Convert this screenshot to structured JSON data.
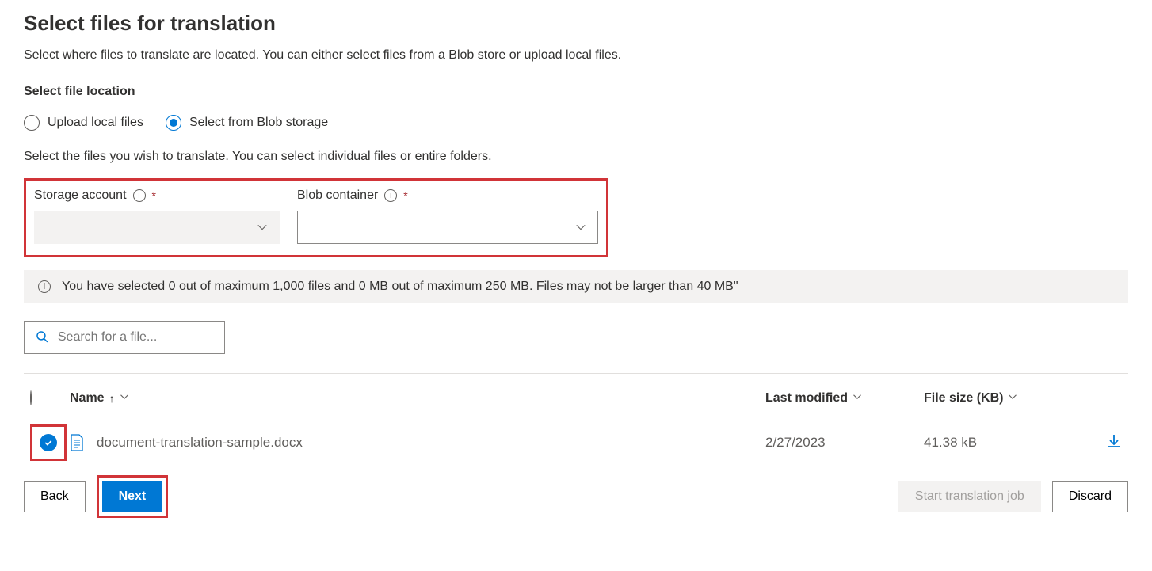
{
  "page": {
    "title": "Select files for translation",
    "subtitle": "Select where files to translate are located. You can either select files from a Blob store or upload local files.",
    "sectionLabel": "Select file location",
    "instruction": "Select the files you wish to translate. You can select individual files or entire folders."
  },
  "radios": {
    "uploadLocal": "Upload local files",
    "selectBlob": "Select from Blob storage"
  },
  "fields": {
    "storageAccount": "Storage account",
    "blobContainer": "Blob container"
  },
  "infoBar": "You have selected 0 out of maximum 1,000 files and 0 MB out of maximum 250 MB. Files may not be larger than 40 MB\"",
  "search": {
    "placeholder": "Search for a file..."
  },
  "tableHeaders": {
    "name": "Name",
    "lastModified": "Last modified",
    "fileSize": "File size (KB)"
  },
  "rows": [
    {
      "name": "document-translation-sample.docx",
      "lastModified": "2/27/2023",
      "fileSize": "41.38 kB",
      "selected": true
    }
  ],
  "buttons": {
    "back": "Back",
    "next": "Next",
    "start": "Start translation job",
    "discard": "Discard"
  }
}
